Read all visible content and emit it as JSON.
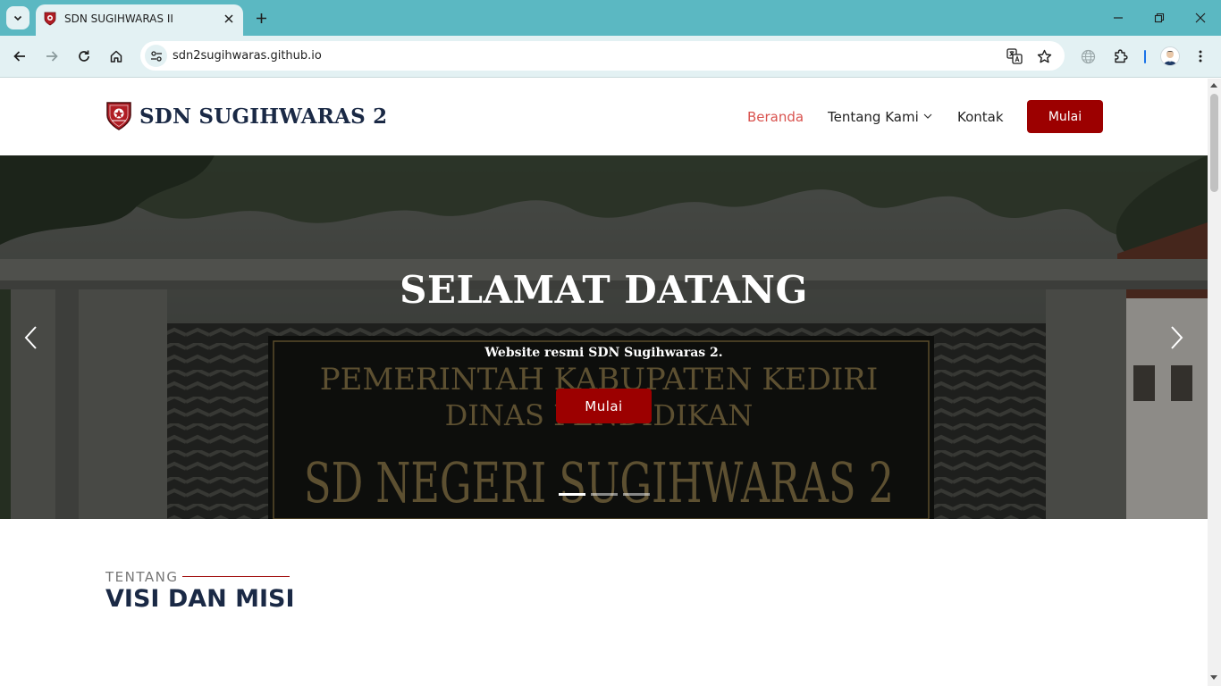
{
  "browser": {
    "tab": {
      "title": "SDN SUGIHWARAS II"
    },
    "address": {
      "url": "sdn2sugihwaras.github.io"
    },
    "icons": [
      "tab-search-icon",
      "close-icon",
      "plus-icon",
      "minimize-icon",
      "restore-icon",
      "back-icon",
      "forward-icon",
      "reload-icon",
      "home-icon",
      "site-info-icon",
      "translate-icon",
      "star-icon",
      "globe-icon",
      "extensions-icon",
      "kebab-menu-icon"
    ]
  },
  "site": {
    "brand": "SDN SUGIHWARAS 2",
    "nav": [
      {
        "label": "Beranda",
        "active": true
      },
      {
        "label": "Tentang Kami",
        "dropdown": true
      },
      {
        "label": "Kontak"
      }
    ],
    "cta_label": "Mulai"
  },
  "hero": {
    "title": "SELAMAT DATANG",
    "subtitle": "Website resmi SDN Sugihwaras 2.",
    "button_label": "Mulai",
    "slides": 3,
    "active_slide": 1
  },
  "about": {
    "kicker": "TENTANG",
    "title": "VISI DAN MISI"
  },
  "colors": {
    "tabstrip": "#5bb8c2",
    "toolbar": "#e3f1f3",
    "accent": "#9c0000",
    "brand_text": "#1a2945",
    "nav_active": "#d9534f"
  }
}
